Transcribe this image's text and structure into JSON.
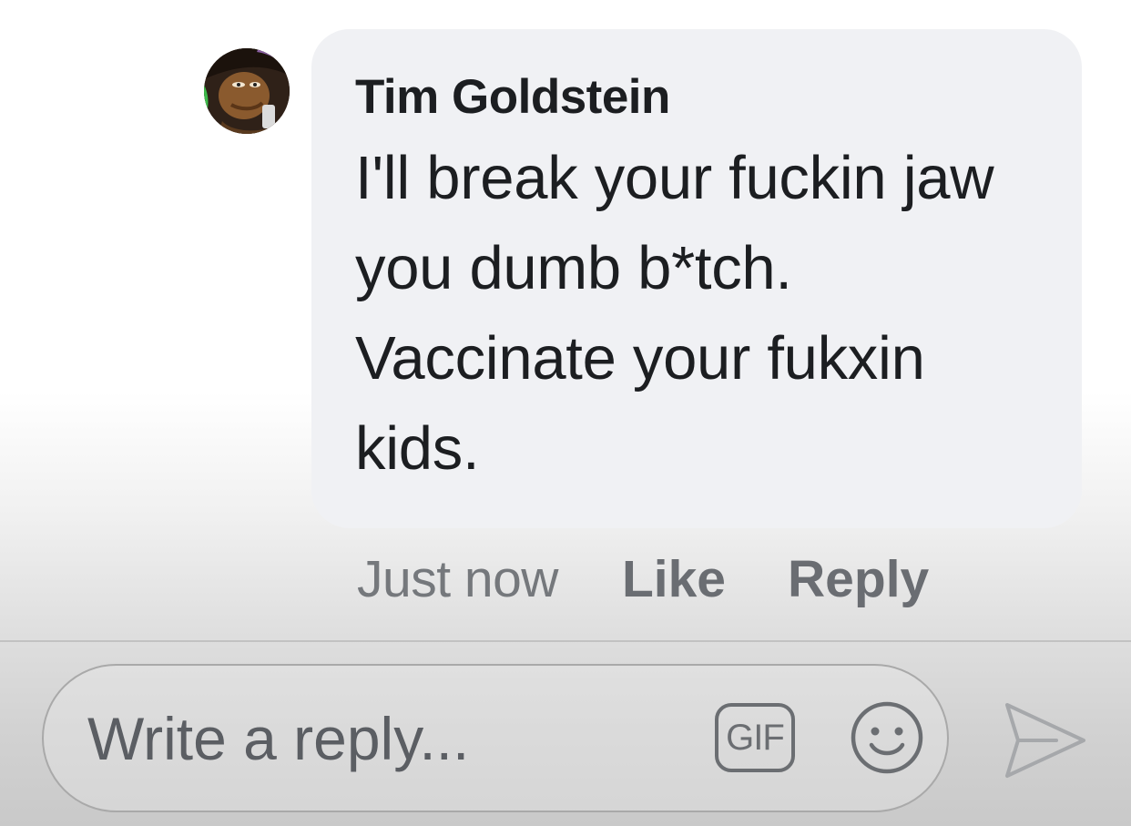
{
  "comment": {
    "author": "Tim Goldstein",
    "message": "I'll break your fuckin jaw you dumb b*tch. Vaccinate your fukxin kids.",
    "avatar_icon": "user-avatar",
    "bubble_color": "#f0f1f4"
  },
  "meta": {
    "timestamp": "Just now",
    "like_label": "Like",
    "reply_label": "Reply"
  },
  "composer": {
    "placeholder": "Write a reply...",
    "gif_label": "GIF",
    "emoji_icon": "smiley-icon",
    "send_icon": "send-icon"
  }
}
